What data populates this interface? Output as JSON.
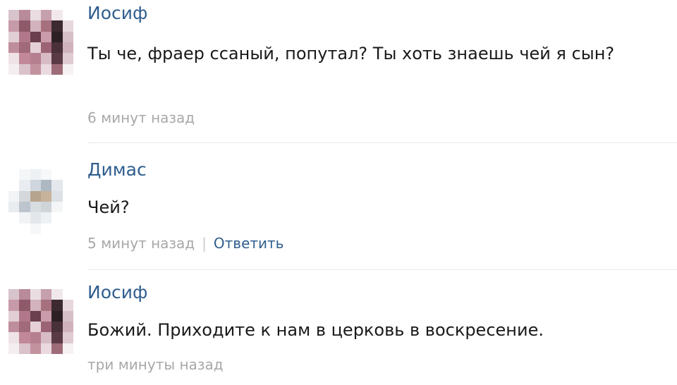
{
  "comments": [
    {
      "author": "Иосиф",
      "text": "Ты че, фраер ссаный, попутал? Ты хоть знаешь чей я сын?",
      "time": "6 минут назад",
      "avatar_colors": [
        "#d8c4cc",
        "#b98a99",
        "#e9dde2",
        "#c7a0ad",
        "#f0e8eb",
        "#ffffff",
        "#c79aa9",
        "#8e5a6a",
        "#d2b3bd",
        "#a6707f",
        "#3c2a30",
        "#e7d8dd",
        "#e2cfd6",
        "#b0788a",
        "#6b3f4d",
        "#c99bab",
        "#2c2024",
        "#d6bfc7",
        "#bf8e9d",
        "#a06a7a",
        "#e5d0d7",
        "#9b6474",
        "#4a3038",
        "#cfb2bc",
        "#efe3e7",
        "#c08898",
        "#b67f90",
        "#d7bcc5",
        "#5a3a44",
        "#e0cbd2",
        "#f4eef0",
        "#d9c2ca",
        "#c3929f",
        "#ead9df",
        "#9e6b79",
        "#f6f1f3"
      ]
    },
    {
      "author": "Димас",
      "text": "Чей?",
      "time": "5 минут назад",
      "reply_label": "Ответить",
      "avatar_colors": [
        "#ffffff",
        "#f4f6f8",
        "#eef1f4",
        "#f7f8fa",
        "#ffffff",
        "#ffffff",
        "#ffffff",
        "#e9edf1",
        "#cfd6dd",
        "#aeb8c2",
        "#e4e8ec",
        "#ffffff",
        "#f2f4f6",
        "#d5d8da",
        "#b7a48f",
        "#c7b29b",
        "#dde1e5",
        "#ffffff",
        "#e8ecef",
        "#bcc5cd",
        "#d8dde2",
        "#cfd4d9",
        "#f3f5f7",
        "#ffffff",
        "#ffffff",
        "#f1f3f5",
        "#e3e7eb",
        "#eef1f3",
        "#ffffff",
        "#ffffff",
        "#ffffff",
        "#ffffff",
        "#f6f7f9",
        "#ffffff",
        "#ffffff",
        "#ffffff"
      ]
    },
    {
      "author": "Иосиф",
      "text": "Божий. Приходите к нам в церковь в воскресение.",
      "time": "три минуты назад",
      "avatar_colors": [
        "#d8c4cc",
        "#b98a99",
        "#e9dde2",
        "#c7a0ad",
        "#f0e8eb",
        "#ffffff",
        "#c79aa9",
        "#8e5a6a",
        "#d2b3bd",
        "#a6707f",
        "#3c2a30",
        "#e7d8dd",
        "#e2cfd6",
        "#b0788a",
        "#6b3f4d",
        "#c99bab",
        "#2c2024",
        "#d6bfc7",
        "#bf8e9d",
        "#a06a7a",
        "#e5d0d7",
        "#9b6474",
        "#4a3038",
        "#cfb2bc",
        "#efe3e7",
        "#c08898",
        "#b67f90",
        "#d7bcc5",
        "#5a3a44",
        "#e0cbd2",
        "#f4eef0",
        "#d9c2ca",
        "#c3929f",
        "#ead9df",
        "#9e6b79",
        "#f6f1f3"
      ]
    }
  ]
}
